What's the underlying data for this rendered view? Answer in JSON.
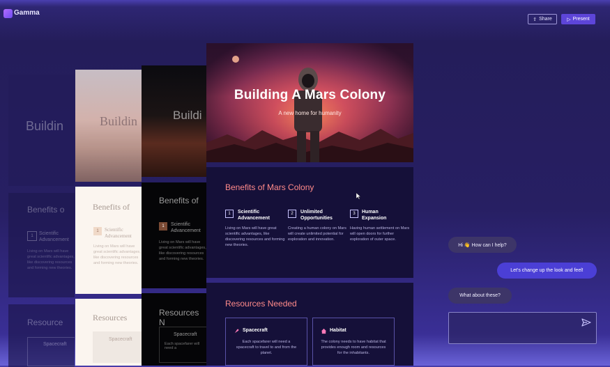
{
  "app": {
    "name": "Gamma"
  },
  "toolbar": {
    "share_label": "Share",
    "present_label": "Present"
  },
  "deck": {
    "title": "Building A Mars Colony",
    "subtitle": "A new home for humanity",
    "ghost_titles": [
      "Buildin",
      "Buildin",
      "Buildi"
    ],
    "benefits_heading": "Benefits of Mars Colony",
    "benefits_ghost": [
      "Benefits o",
      "Benefits of",
      "Benefits of"
    ],
    "benefits": [
      {
        "num": "1",
        "title_line1": "Scientific",
        "title_line2": "Advancement",
        "body": "Living on Mars will have great scientific advantages, like discovering resources and forming new theories."
      },
      {
        "num": "2",
        "title_line1": "Unlimited",
        "title_line2": "Opportunities",
        "body": "Creating a human colony on Mars will create unlimited potential for exploration and innovation."
      },
      {
        "num": "3",
        "title_line1": "Human",
        "title_line2": "Expansion",
        "body": "Having human settlement on Mars will open doors for further exploration of outer space."
      }
    ],
    "resources_heading": "Resources Needed",
    "resources_ghost": [
      "Resource",
      "Resources",
      "Resources N"
    ],
    "resources": [
      {
        "title": "Spacecraft",
        "body": "Each spacefarer will need a spacecraft to travel to and from the planet."
      },
      {
        "title": "Habitat",
        "body": "The colony needs to have habitat that provides enough room and resources for the inhabitants."
      }
    ],
    "ghost_spacecraft": "Spacecraft",
    "ghost_spacecraft_body": "Each spacefarer will need a",
    "ghost_benefit_title1": "Scientific",
    "ghost_benefit_title2": "Advancement",
    "ghost_benefit_body": "Living on Mars will have great scientific advantages, like discovering resources and forming new theories."
  },
  "chat": {
    "messages": [
      {
        "from": "assistant",
        "text": "Hi 👋 How can I help?"
      },
      {
        "from": "user",
        "text": "Let's change up the look and feel!"
      },
      {
        "from": "assistant",
        "text": "What about these?"
      }
    ],
    "input_value": ""
  },
  "colors": {
    "accent": "#5d45d9",
    "heading": "#ff8a8a",
    "user_bubble": "#4b3fd6",
    "assistant_bubble": "#3d3568"
  }
}
